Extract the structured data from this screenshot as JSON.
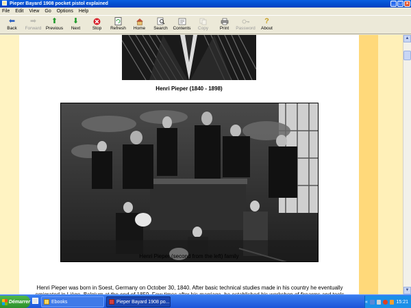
{
  "window": {
    "title": "Pieper Bayard 1908 pocket pistol explained"
  },
  "menu": [
    "File",
    "Edit",
    "View",
    "Go",
    "Options",
    "Help"
  ],
  "toolbar": [
    {
      "label": "Back",
      "icon": "back-arrow-icon",
      "enabled": true
    },
    {
      "label": "Forward",
      "icon": "forward-arrow-icon",
      "enabled": false
    },
    {
      "label": "Previous",
      "icon": "up-arrow-icon",
      "enabled": true
    },
    {
      "label": "Next",
      "icon": "down-arrow-icon",
      "enabled": true
    },
    {
      "label": "Stop",
      "icon": "stop-icon",
      "enabled": true
    },
    {
      "label": "Refresh",
      "icon": "refresh-icon",
      "enabled": true
    },
    {
      "label": "Home",
      "icon": "home-icon",
      "enabled": true
    },
    {
      "label": "Search",
      "icon": "search-icon",
      "enabled": true
    },
    {
      "label": "Contents",
      "icon": "contents-icon",
      "enabled": true
    },
    {
      "label": "Copy",
      "icon": "copy-icon",
      "enabled": false
    },
    {
      "label": "Print",
      "icon": "print-icon",
      "enabled": true
    },
    {
      "label": "Password",
      "icon": "key-icon",
      "enabled": false
    },
    {
      "label": "About",
      "icon": "about-icon",
      "enabled": true
    }
  ],
  "content": {
    "caption1": "Henri Pieper (1840 - 1898)",
    "caption2": "Henri Pieper (second from the left) family",
    "body": "Henri Pieper was born in Soest, Germany on October 30, 1840. After basic technical studies made in his country he eventually emigrated in Liège, Belgium at the end of 1859. Few times after his marriage, he established his workshop of firearms and tools"
  },
  "taskbar": {
    "start_label": "Démarrer",
    "buttons": [
      {
        "label": "Ebooks",
        "active": false
      },
      {
        "label": "Pieper Bayard 1908 po...",
        "active": true
      }
    ],
    "clock": "15:21"
  },
  "colors": {
    "titlebar": "#0a5fe0",
    "page_bg": "#ffffff",
    "margin_band": "#ffd97a",
    "taskbar": "#1c55d8"
  }
}
